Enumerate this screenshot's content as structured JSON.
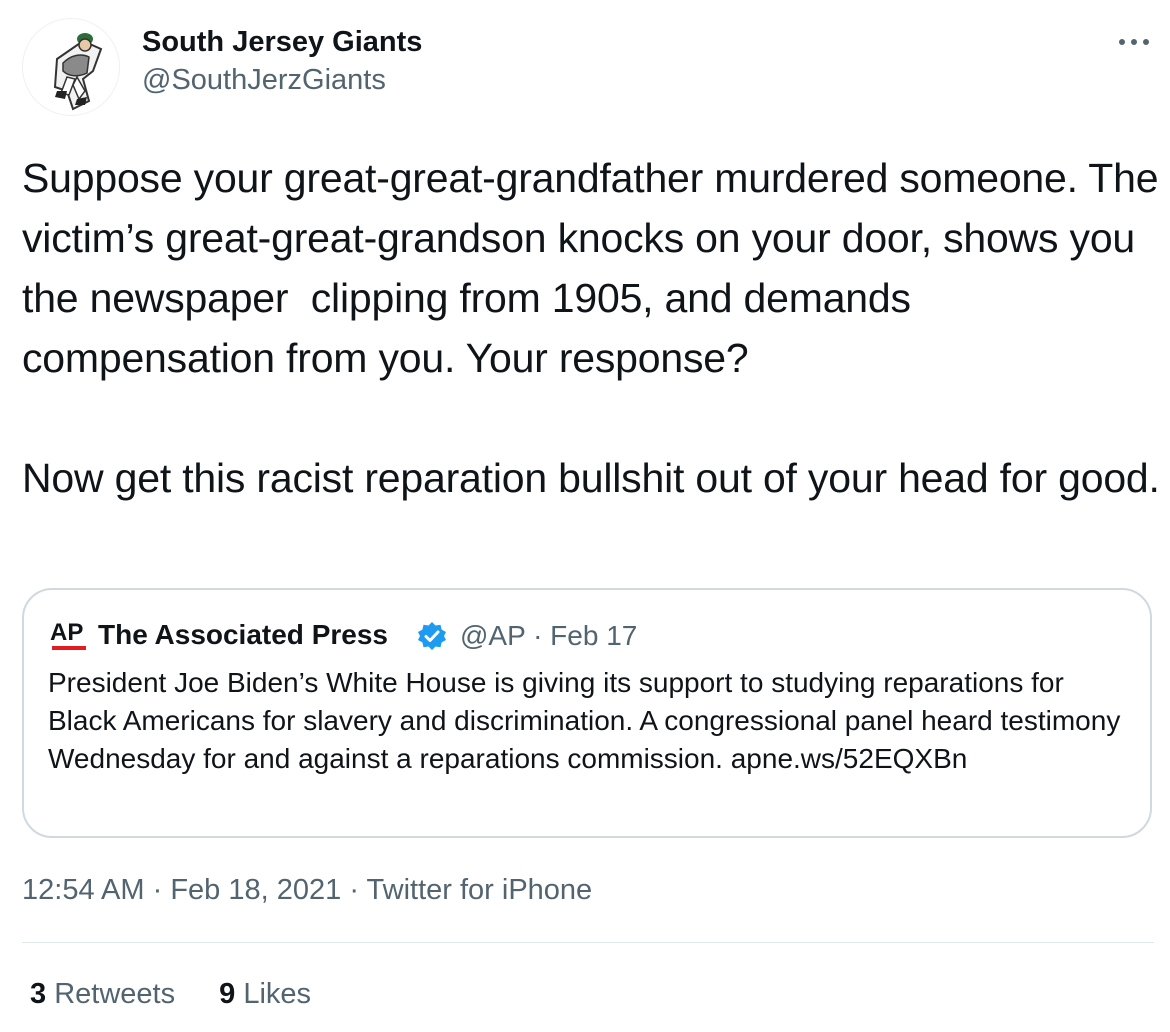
{
  "tweet": {
    "author": {
      "display_name": "South Jersey Giants",
      "handle": "@SouthJerzGiants",
      "avatar_icon": "baseball-player-icon"
    },
    "more_icon": "more-dots-icon",
    "text": "Suppose your great-great-grandfather murdered someone. The victim’s great-great-grandson knocks on your door, shows you the newspaper  clipping from 1905, and demands compensation from you. Your response?\n\nNow get this racist reparation bullshit out of your head for good.",
    "quoted": {
      "logo_text": "AP",
      "display_name": "The Associated Press",
      "verified_icon": "verified-badge-icon",
      "handle": "@AP",
      "separator": "·",
      "date": "Feb 17",
      "text": "President Joe Biden’s White House is giving its support to studying reparations for Black Americans for slavery and discrimination. A congressional panel heard testimony Wednesday for and against a reparations commission. apne.ws/52EQXBn"
    },
    "time": "12:54 AM",
    "sep1": "·",
    "date": "Feb 18, 2021",
    "sep2": "·",
    "source": "Twitter for iPhone",
    "retweets_count": "3",
    "retweets_label": "Retweets",
    "likes_count": "9",
    "likes_label": "Likes"
  },
  "colors": {
    "text": "#0f1419",
    "secondary": "#536471",
    "border": "#cfd9de",
    "verified": "#1d9bf0",
    "ap_red": "#e31b23"
  }
}
